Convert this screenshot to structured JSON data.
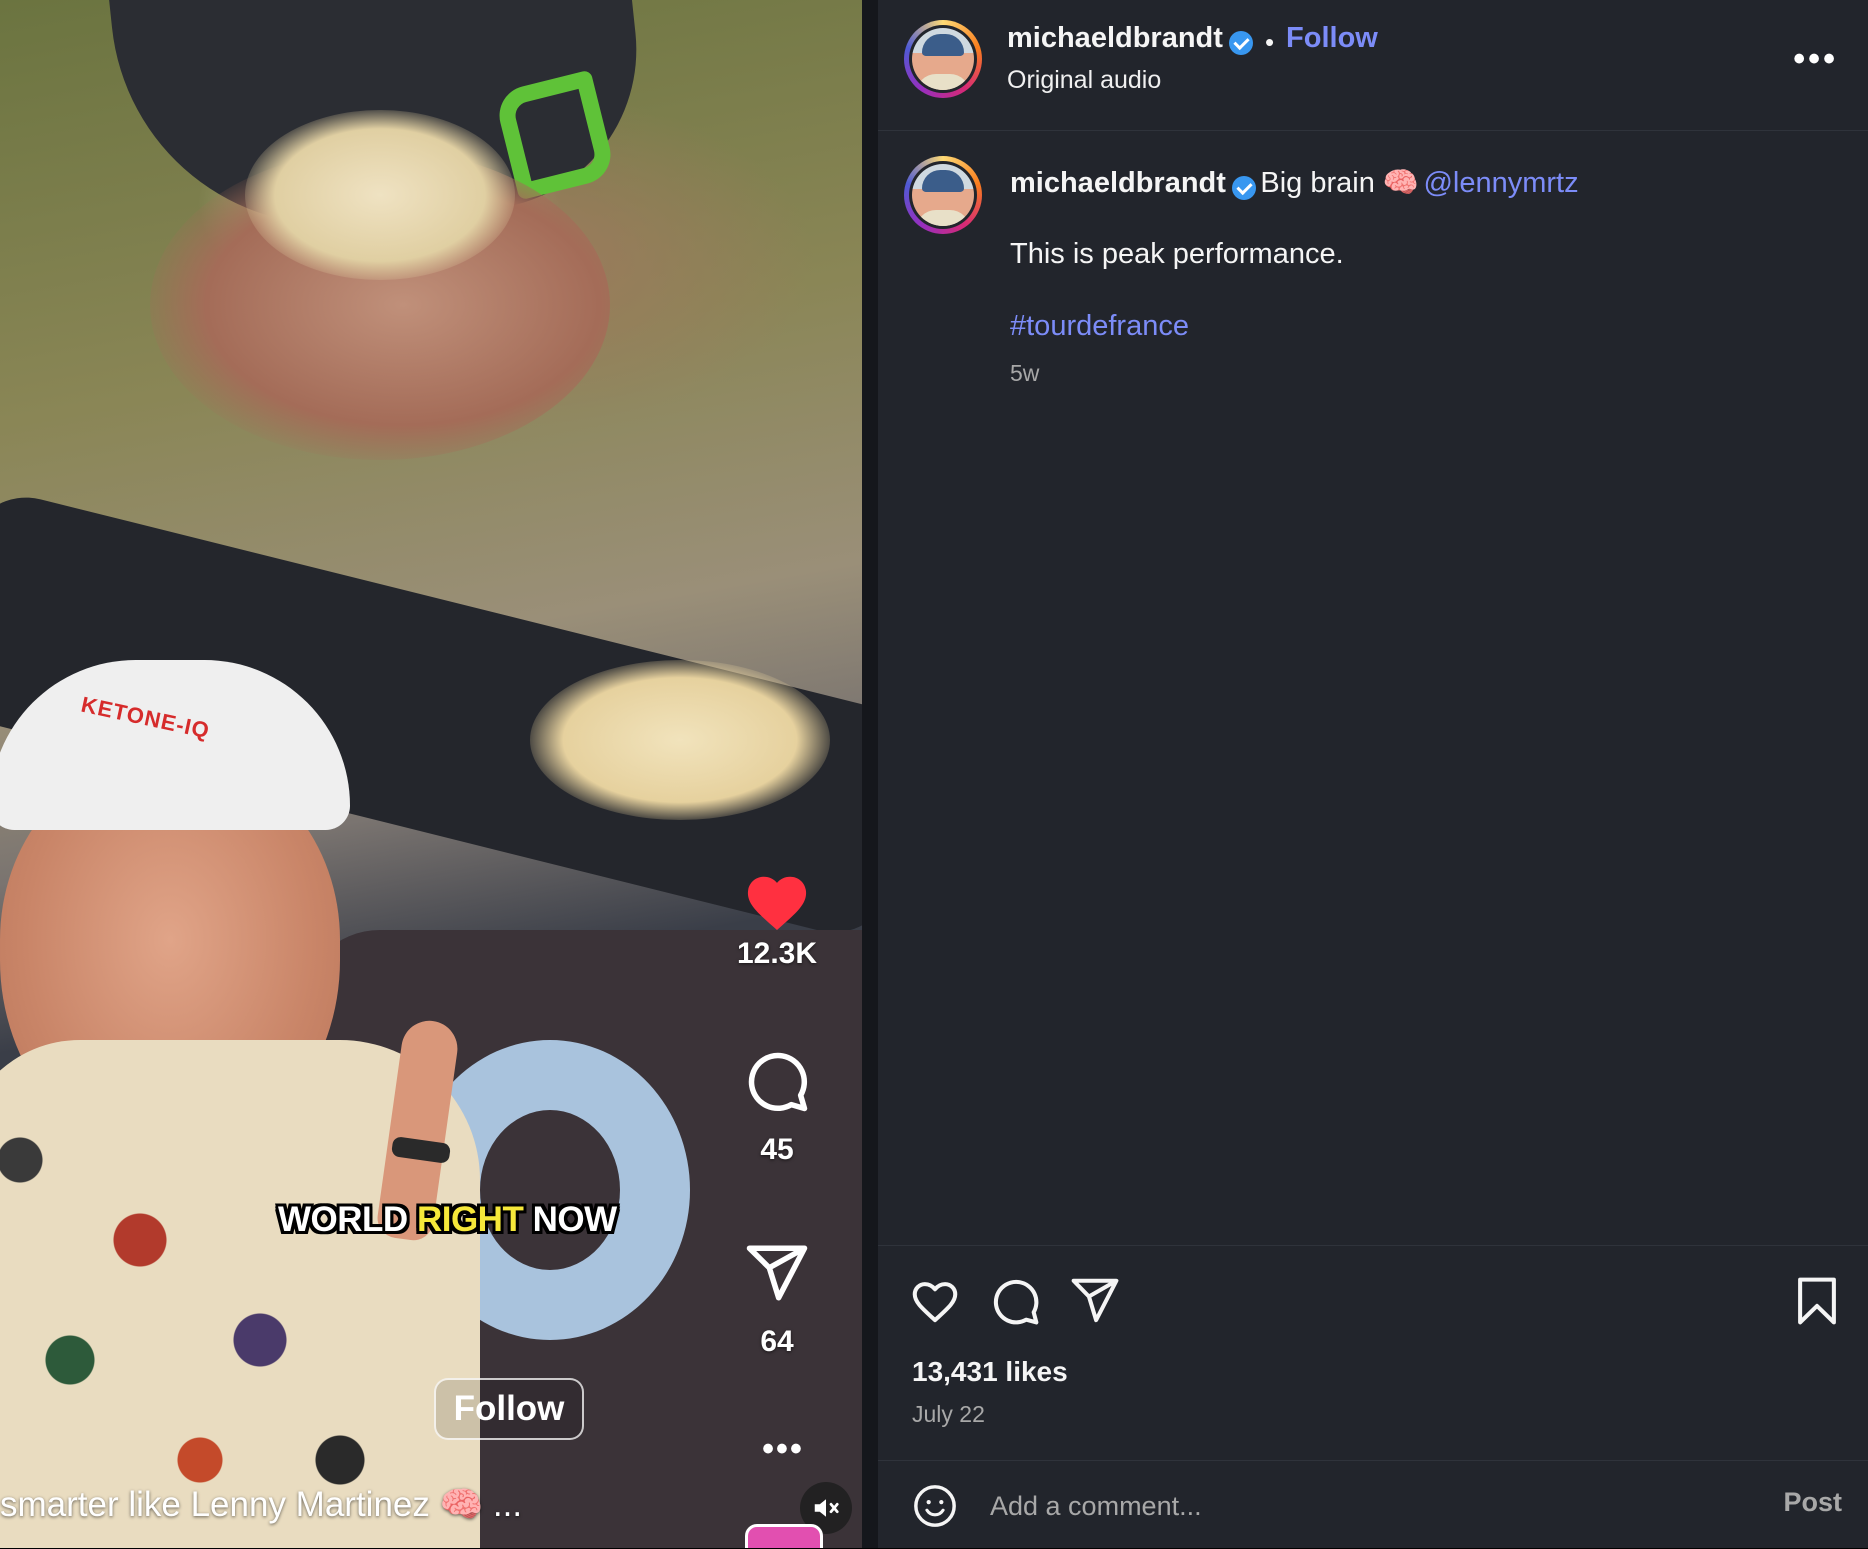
{
  "video": {
    "overlay_caption_word1": "WORLD",
    "overlay_caption_word2": "RIGHT",
    "overlay_caption_word3": "NOW",
    "cap_brand": "KETONE-IQ",
    "likes_count": "12.3K",
    "comments_count": "45",
    "shares_count": "64",
    "follow_label": "Follow",
    "caption_text": "smarter like Lenny Martinez 🧠 ...",
    "colors": {
      "liked_heart": "#ff3040",
      "highlight": "#f6e83a"
    },
    "icons": [
      "heart-icon",
      "comment-icon",
      "share-icon",
      "more-icon",
      "mute-icon"
    ]
  },
  "header": {
    "username": "michaeldbrandt",
    "separator": "•",
    "follow_label": "Follow",
    "audio_label": "Original audio",
    "more_label": "•••"
  },
  "post": {
    "username": "michaeldbrandt",
    "caption_prefix": "Big brain 🧠",
    "mention": "@lennymrtz",
    "body": "This is peak performance.",
    "hashtag": "#tourdefrance",
    "time_ago": "5w"
  },
  "actions": {
    "likes": "13,431 likes",
    "date": "July 22",
    "icons": [
      "like-icon",
      "comment-icon",
      "share-icon",
      "save-icon"
    ]
  },
  "comment": {
    "placeholder": "Add a comment...",
    "post_label": "Post"
  },
  "colors": {
    "panel_bg": "#22252c",
    "link": "#7c8cf8",
    "verified": "#3897f0",
    "muted_text": "#a8a8a8"
  }
}
